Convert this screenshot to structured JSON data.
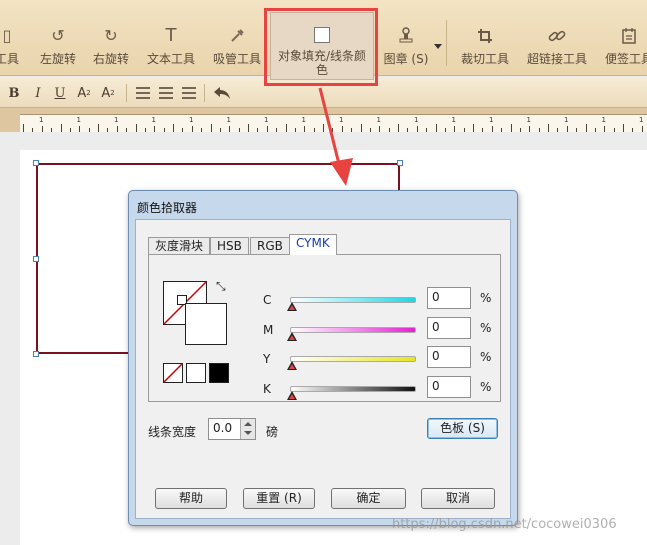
{
  "toolbar": {
    "items": [
      {
        "label": "工具",
        "icon": "hand-icon"
      },
      {
        "label": "左旋转",
        "icon": "rotate-left-icon"
      },
      {
        "label": "右旋转",
        "icon": "rotate-right-icon"
      },
      {
        "label": "文本工具",
        "icon": "text-tool-icon"
      },
      {
        "label": "吸管工具",
        "icon": "eyedropper-icon"
      },
      {
        "label": "对象填充/线条颜色",
        "icon": "fill-color-icon"
      },
      {
        "label": "图章 (S)",
        "icon": "stamp-icon"
      },
      {
        "label": "裁切工具",
        "icon": "crop-icon"
      },
      {
        "label": "超链接工具",
        "icon": "link-icon"
      },
      {
        "label": "便签工具",
        "icon": "note-icon"
      }
    ]
  },
  "formatbar": {
    "bold": "B",
    "italic": "I",
    "underline": "U",
    "superscript": "A",
    "superscript_mark": "2",
    "subscript": "A",
    "subscript_mark": "2"
  },
  "ruler": {
    "labels": [
      "1",
      "1",
      "1",
      "1",
      "1",
      "1",
      "1",
      "1",
      "1",
      "1",
      "1",
      "1",
      "1",
      "1",
      "1",
      "1",
      "1"
    ]
  },
  "dialog": {
    "title": "颜色拾取器",
    "tabs": [
      "灰度滑块",
      "HSB",
      "RGB",
      "CYMK"
    ],
    "active_tab": "CYMK",
    "channels": [
      {
        "letter": "C",
        "value": "0",
        "unit": "%",
        "color": "#1fd6e6"
      },
      {
        "letter": "M",
        "value": "0",
        "unit": "%",
        "color": "#e61fd6"
      },
      {
        "letter": "Y",
        "value": "0",
        "unit": "%",
        "color": "#e6e61f"
      },
      {
        "letter": "K",
        "value": "0",
        "unit": "%",
        "color": "#111111"
      }
    ],
    "line_width": {
      "label": "线条宽度",
      "value": "0.0",
      "unit": "磅"
    },
    "palette_button": "色板 (S)",
    "buttons": {
      "help": "帮助",
      "reset": "重置 (R)",
      "ok": "确定",
      "cancel": "取消"
    }
  },
  "watermark": "https://blog.csdn.net/cocowei0306",
  "colors": {
    "highlight": "#e84340",
    "shape_border": "#7a1024"
  }
}
